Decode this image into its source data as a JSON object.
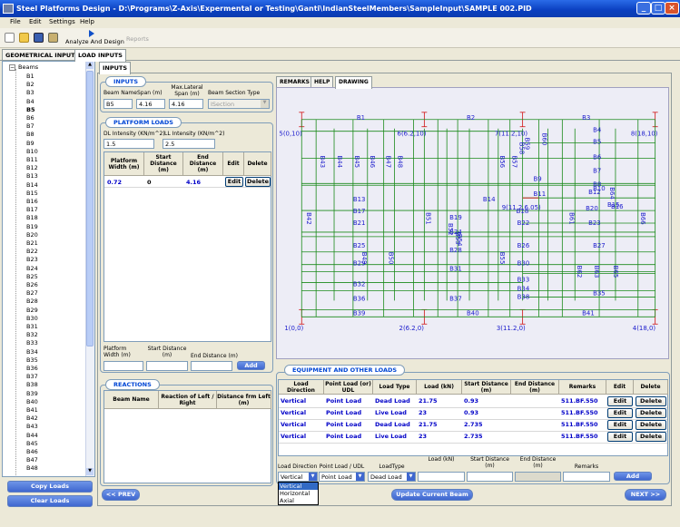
{
  "window": {
    "title": "Steel Platforms Design - D:\\Programs\\Z-Axis\\Expermental or Testing\\Ganti\\IndianSteelMembers\\SampleInput\\SAMPLE 002.PID"
  },
  "menu": [
    "File",
    "Edit",
    "Settings",
    "Help"
  ],
  "toolbar": {
    "analyze": "Analyze And Design",
    "reports": "Reports"
  },
  "tabs": [
    "GEOMETRICAL INPUTS",
    "LOAD INPUTS"
  ],
  "subtab": "INPUTS",
  "tree": {
    "root": "Beams",
    "items": [
      "B1",
      "B2",
      "B3",
      "B4",
      "B5",
      "B6",
      "B7",
      "B8",
      "B9",
      "B10",
      "B11",
      "B12",
      "B13",
      "B14",
      "B15",
      "B16",
      "B17",
      "B18",
      "B19",
      "B20",
      "B21",
      "B22",
      "B23",
      "B24",
      "B25",
      "B26",
      "B27",
      "B28",
      "B29",
      "B30",
      "B31",
      "B32",
      "B33",
      "B34",
      "B35",
      "B36",
      "B37",
      "B38",
      "B39",
      "B40",
      "B41",
      "B42",
      "B43",
      "B44",
      "B45",
      "B46",
      "B47",
      "B48"
    ],
    "selected": "B5"
  },
  "buttons": {
    "copy_loads": "Copy Loads",
    "clear_loads": "Clear Loads",
    "prev": "<< PREV",
    "update": "Update Current Beam",
    "next": "NEXT >>"
  },
  "inputs": {
    "title": "INPUTS",
    "beam_name_label": "Beam Name",
    "span_label": "Span (m)",
    "maxlat_label": "Max.Lateral Span (m)",
    "section_label": "Beam Section Type",
    "beam_name": "B5",
    "span": "4.16",
    "maxlat": "4.16",
    "section": "ISection"
  },
  "platform": {
    "title": "PLATFORM LOADS",
    "dl_label": "DL Intensity (KN/m^2)",
    "ll_label": "LL Intensity (KN/m^2)",
    "dl": "1.5",
    "ll": "2.5",
    "headers": [
      "Platform Width (m)",
      "Start Distance (m)",
      "End Distance (m)",
      "Edit",
      "Delete"
    ],
    "row": [
      "0.72",
      "0",
      "4.16"
    ],
    "edit": "Edit",
    "delete": "Delete",
    "add_labels": [
      "Platform Width (m)",
      "Start Distance (m)",
      "End Distance (m)"
    ],
    "add": "Add"
  },
  "reactions": {
    "title": "REACTIONS",
    "headers": [
      "Beam Name",
      "Reaction of Left / Right",
      "Distance frm Left (m)"
    ]
  },
  "right_tabs": [
    "REMARKS",
    "HELP",
    "DRAWING"
  ],
  "drawing": {
    "nodes": [
      {
        "label": "5(0,10)"
      },
      {
        "label": "6(6.2,10)"
      },
      {
        "label": "7(11.2,10)"
      },
      {
        "label": "8(18,10)"
      },
      {
        "label": "1(0,0)"
      },
      {
        "label": "2(6.2,0)"
      },
      {
        "label": "3(11.2,0)"
      },
      {
        "label": "4(18,0)"
      },
      {
        "label": "9(11.2,6.05)"
      }
    ],
    "h_beams": [
      "B1",
      "B2",
      "B3",
      "B4",
      "B5",
      "B6",
      "B7",
      "B8",
      "B9",
      "B10",
      "B11",
      "B12",
      "B13",
      "B14",
      "B15",
      "B16",
      "B17",
      "B18",
      "B19",
      "B20",
      "B21",
      "B22",
      "B23",
      "B24",
      "B25",
      "B26",
      "B27",
      "B28",
      "B29",
      "B30",
      "B31",
      "B32",
      "B33",
      "B34",
      "B35",
      "B36",
      "B37",
      "B38",
      "B39",
      "B40",
      "B41"
    ],
    "v_beams": [
      "B42",
      "B43",
      "B44",
      "B45",
      "B46",
      "B47",
      "B48",
      "B49",
      "B50",
      "B51",
      "B52",
      "B53",
      "B54",
      "B55",
      "B56",
      "B57",
      "B58",
      "B59",
      "B60",
      "B61",
      "B62",
      "B63",
      "B64",
      "B65",
      "B66"
    ]
  },
  "equipment": {
    "title": "EQUIPMENT AND OTHER LOADS",
    "headers": [
      "Load Direction",
      "Point Load (or) UDL",
      "Load Type",
      "Load (kN)",
      "Start Distance (m)",
      "End Distance (m)",
      "Remarks",
      "Edit",
      "Delete"
    ],
    "rows": [
      [
        "Vertical",
        "Point Load",
        "Dead Load",
        "21.75",
        "0.93",
        "",
        "511.BF.550"
      ],
      [
        "Vertical",
        "Point Load",
        "Live Load",
        "23",
        "0.93",
        "",
        "511.BF.550"
      ],
      [
        "Vertical",
        "Point Load",
        "Dead Load",
        "21.75",
        "2.735",
        "",
        "511.BF.550"
      ],
      [
        "Vertical",
        "Point Load",
        "Live Load",
        "23",
        "2.735",
        "",
        "511.BF.550"
      ]
    ],
    "edit": "Edit",
    "delete": "Delete",
    "add_labels": [
      "Load Direction",
      "Point Load / UDL",
      "LoadType",
      "Load (kN)",
      "Start Distance (m)",
      "End Distance (m)",
      "Remarks"
    ],
    "add_values": {
      "direction": "Vertical",
      "pl": "Point Load",
      "lt": "Dead Load"
    },
    "add": "Add",
    "dropdown": [
      "Vertical",
      "Horizontal",
      "Axial"
    ]
  }
}
